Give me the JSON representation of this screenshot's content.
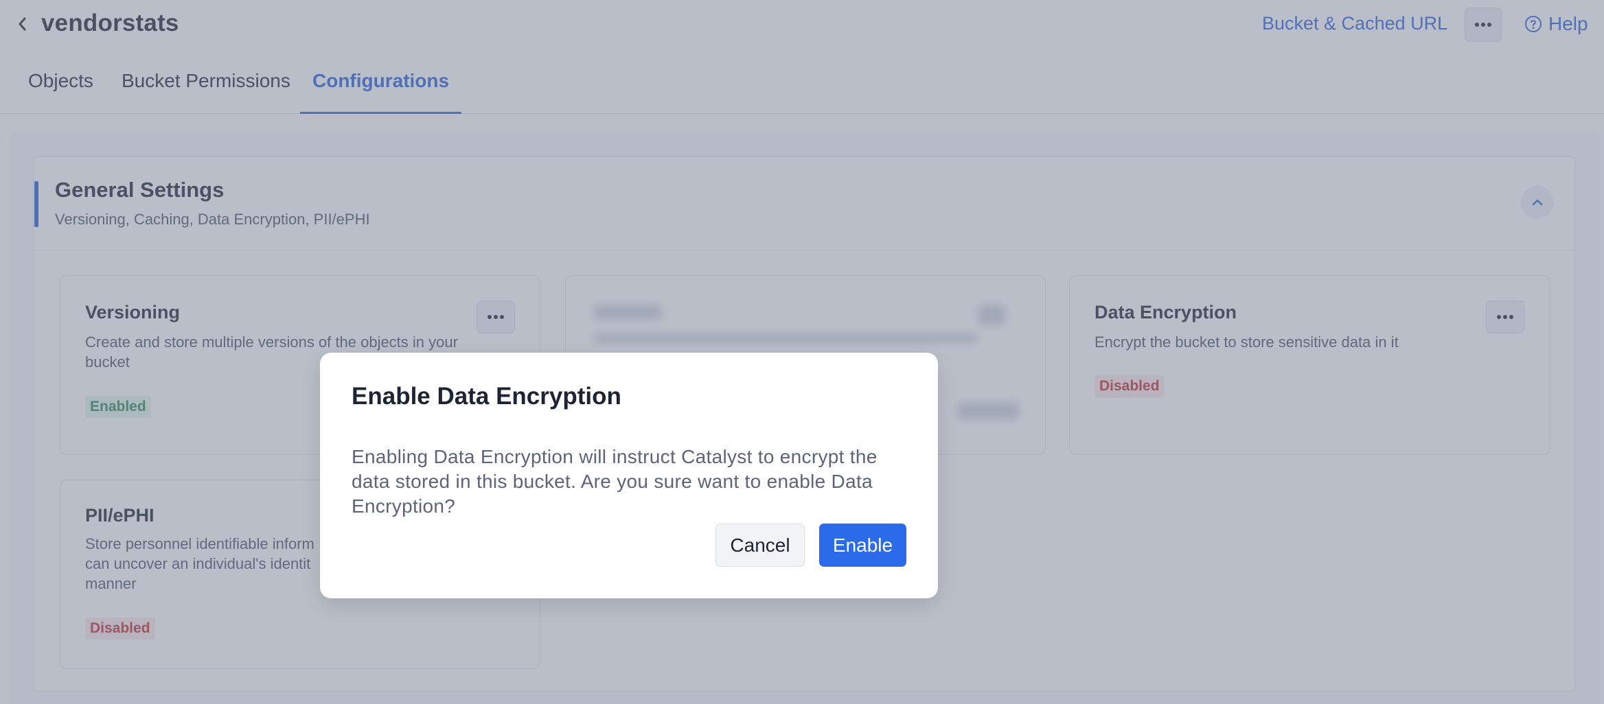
{
  "header": {
    "title": "vendorstats",
    "bucket_url_link": "Bucket & Cached URL",
    "help_label": "Help"
  },
  "tabs": [
    {
      "label": "Objects",
      "active": false
    },
    {
      "label": "Bucket Permissions",
      "active": false
    },
    {
      "label": "Configurations",
      "active": true
    }
  ],
  "section": {
    "title": "General Settings",
    "subtitle": "Versioning, Caching, Data Encryption, PII/ePHI"
  },
  "cards": {
    "versioning": {
      "title": "Versioning",
      "description": "Create and store multiple versions of the objects in your bucket",
      "status": "Enabled"
    },
    "data_encryption": {
      "title": "Data Encryption",
      "description": "Encrypt the bucket to store sensitive data in it",
      "status": "Disabled"
    },
    "pii": {
      "title": "PII/ePHI",
      "description_visible": "Store personnel identifiable inform",
      "description_line2": "can uncover an individual's identit",
      "description_line3": "manner",
      "status": "Disabled"
    }
  },
  "modal": {
    "title": "Enable Data Encryption",
    "body": "Enabling Data Encryption will instruct Catalyst to encrypt the data stored in this bucket. Are you sure want to enable Data Encryption?",
    "cancel_label": "Cancel",
    "confirm_label": "Enable"
  },
  "colors": {
    "accent": "#2b63d9",
    "enabled_text": "#2f8a4e",
    "disabled_text": "#c53030",
    "overlay": "rgba(118,126,148,0.5)"
  },
  "icons": {
    "back": "chevron-left-icon",
    "more": "more-horizontal-icon",
    "help": "help-circle-icon",
    "collapse": "chevron-up-icon"
  }
}
